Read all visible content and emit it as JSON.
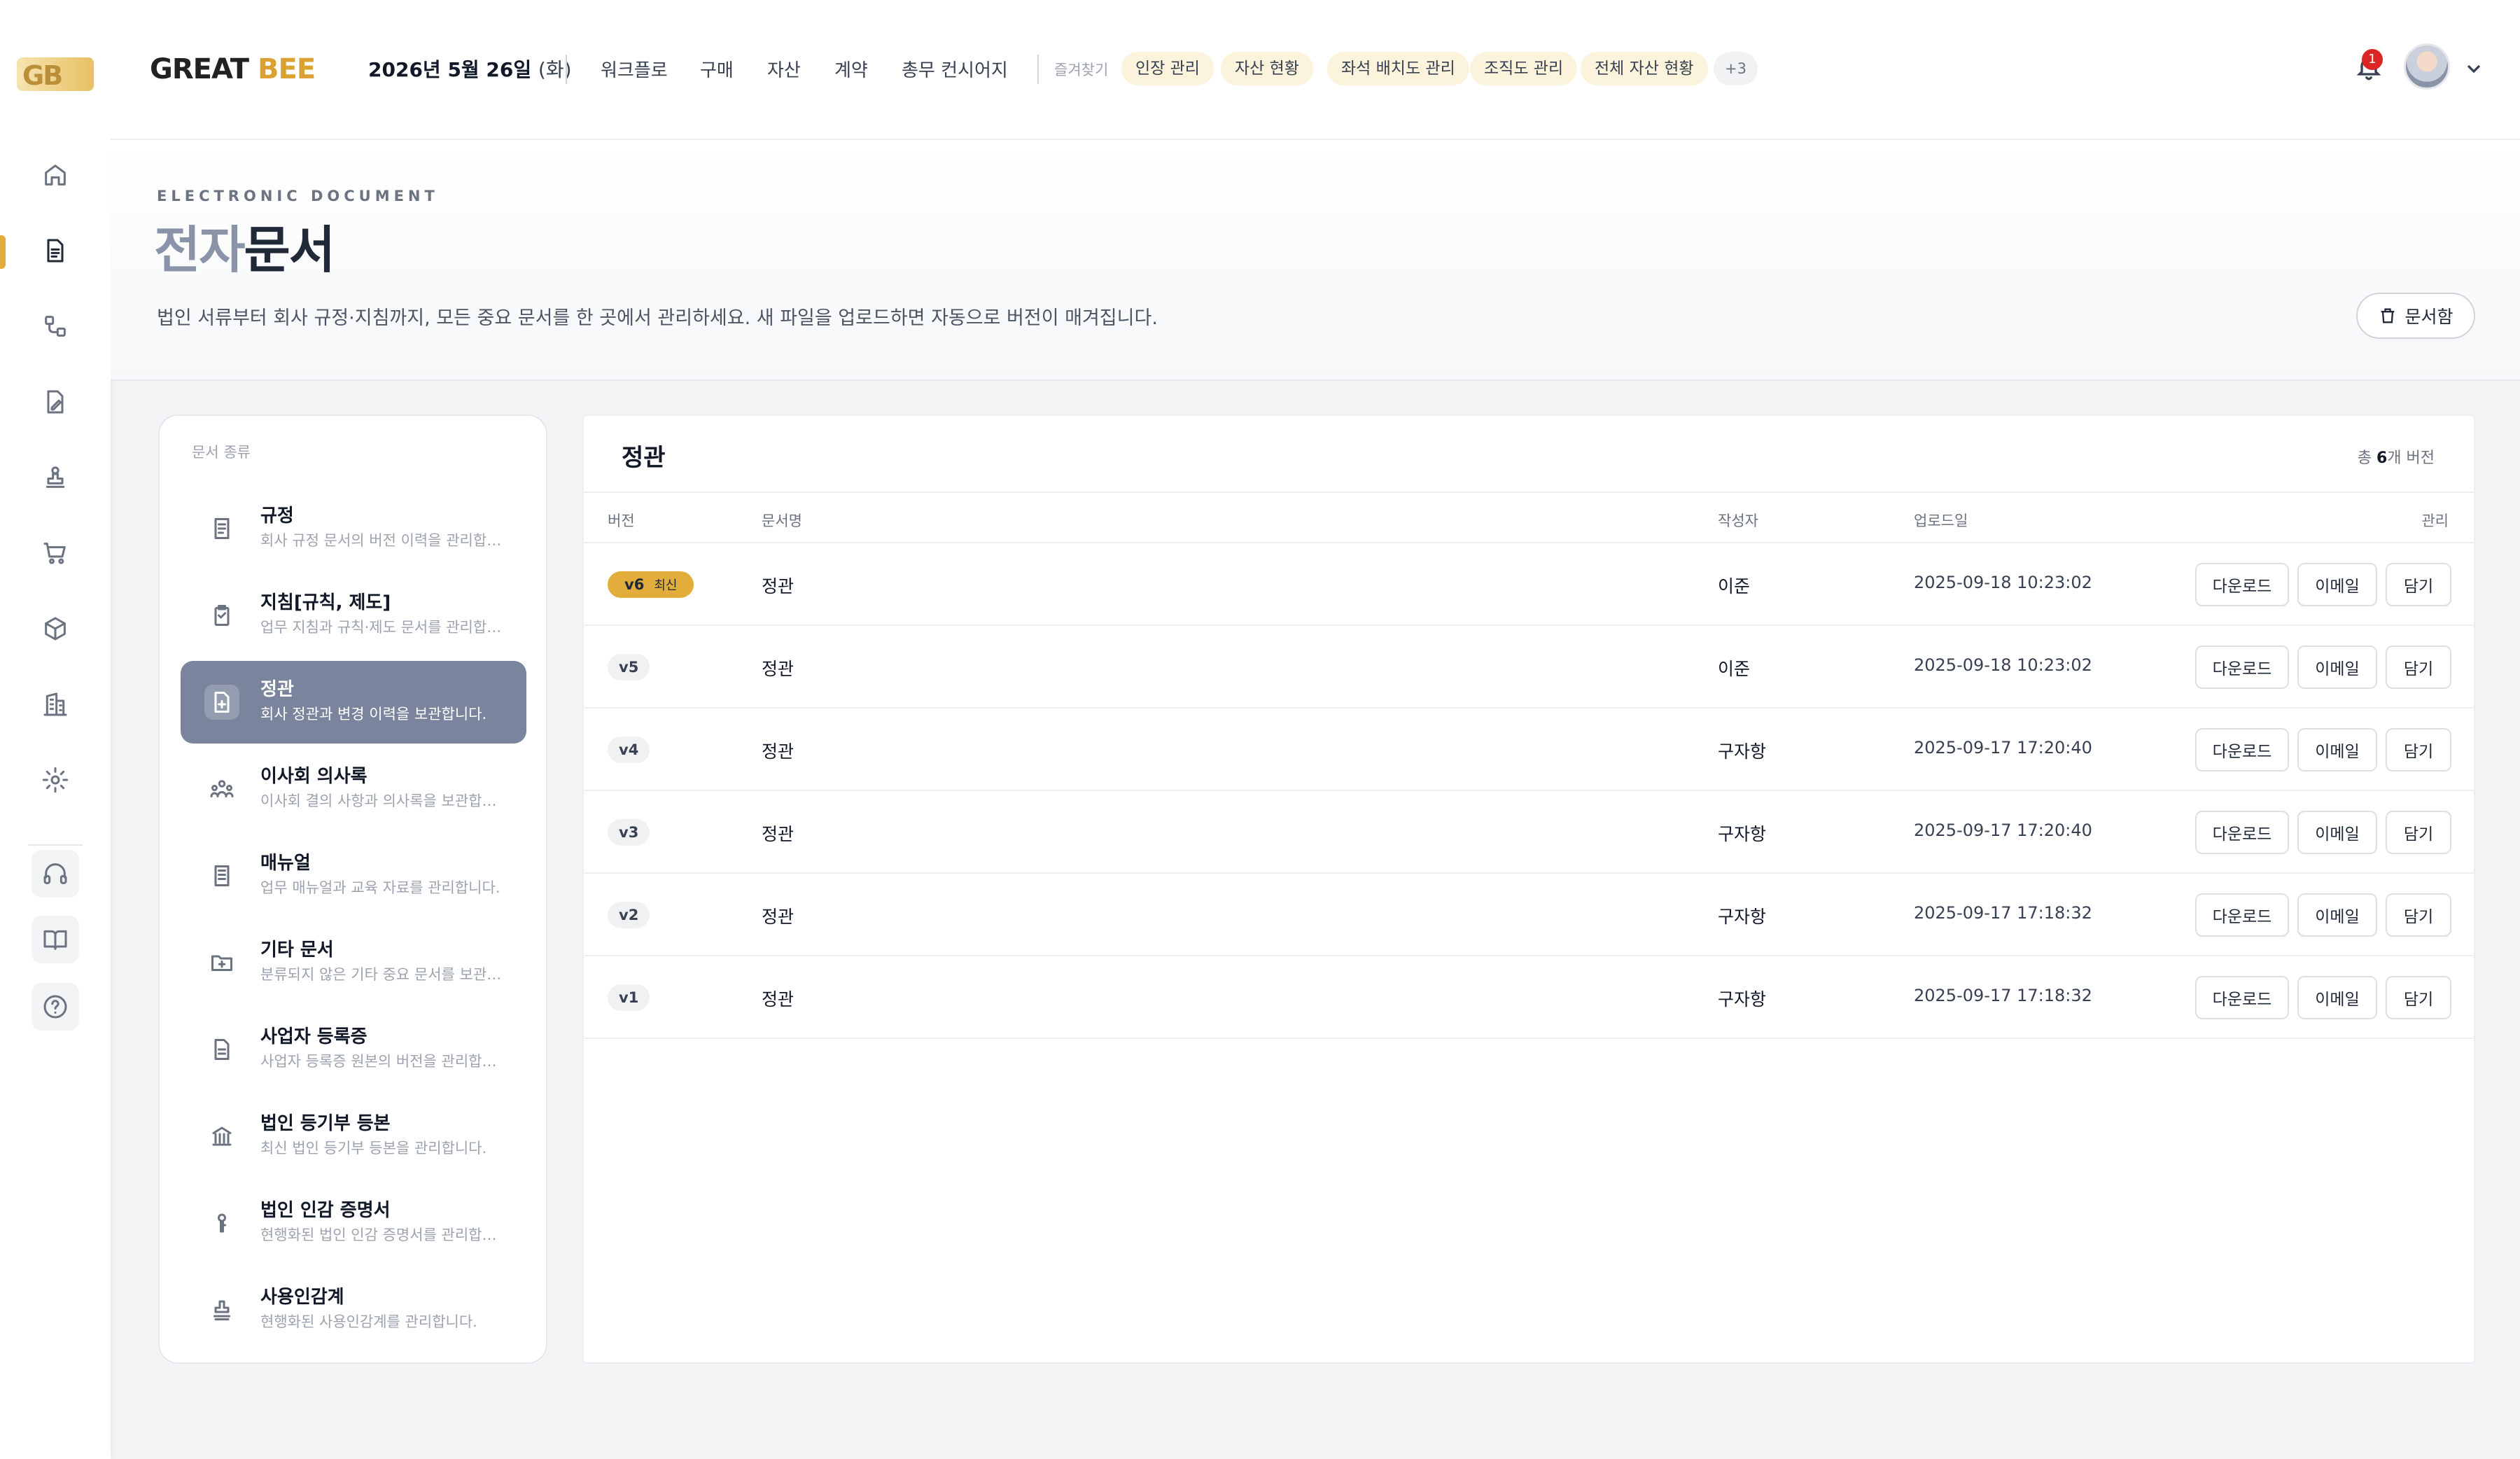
{
  "brand": {
    "logo_mark": "GB",
    "name_left": "GREAT ",
    "name_right": "BEE"
  },
  "header": {
    "date": "2026년 5월 26일",
    "weekday": "(화)",
    "nav": [
      "워크플로",
      "구매",
      "자산",
      "계약",
      "총무 컨시어지"
    ],
    "favorites_label": "즐겨찾기",
    "favorites": [
      "인장 관리",
      "자산 현황",
      "좌석 배치도 관리",
      "조직도 관리",
      "전체 자산 현황"
    ],
    "favorites_more": "+3",
    "notification_count": "1"
  },
  "sidebar_icons": [
    "home-icon",
    "document-icon",
    "workflow-icon",
    "contract-icon",
    "seal-icon",
    "cart-icon",
    "box-icon",
    "building-icon",
    "settings-icon",
    "headset-icon",
    "book-icon",
    "help-icon"
  ],
  "page": {
    "eyebrow": "ELECTRONIC DOCUMENT",
    "title_accent": "전자",
    "title_rest": "문서",
    "description": "법인 서류부터 회사 규정·지침까지, 모든 중요 문서를 한 곳에서 관리하세요. 새 파일을 업로드하면 자동으로 버전이 매겨집니다.",
    "docbox_label": "문서함"
  },
  "categories": {
    "heading": "문서 종류",
    "items": [
      {
        "title": "규정",
        "desc": "회사 규정 문서의 버전 이력을 관리합니다.",
        "icon": "list-doc-icon"
      },
      {
        "title": "지침[규칙, 제도]",
        "desc": "업무 지침과 규칙·제도 문서를 관리합니다.",
        "icon": "clipboard-icon"
      },
      {
        "title": "정관",
        "desc": "회사 정관과 변경 이력을 보관합니다.",
        "icon": "file-plus-icon"
      },
      {
        "title": "이사회 의사록",
        "desc": "이사회 결의 사항과 의사록을 보관합니다.",
        "icon": "people-icon"
      },
      {
        "title": "매뉴얼",
        "desc": "업무 매뉴얼과 교육 자료를 관리합니다.",
        "icon": "manual-icon"
      },
      {
        "title": "기타 문서",
        "desc": "분류되지 않은 기타 중요 문서를 보관합니다.",
        "icon": "folder-plus-icon"
      },
      {
        "title": "사업자 등록증",
        "desc": "사업자 등록증 원본의 버전을 관리합니다.",
        "icon": "file-text-icon"
      },
      {
        "title": "법인 등기부 등본",
        "desc": "최신 법인 등기부 등본을 관리합니다.",
        "icon": "bank-icon"
      },
      {
        "title": "법인 인감 증명서",
        "desc": "현행화된 법인 인감 증명서를 관리합니다.",
        "icon": "stamp-key-icon"
      },
      {
        "title": "사용인감계",
        "desc": "현행화된 사용인감계를 관리합니다.",
        "icon": "stamp-icon"
      }
    ]
  },
  "panel": {
    "title": "정관",
    "count_prefix": "총",
    "count_value": "6",
    "count_suffix": "개 버전",
    "columns": [
      "버전",
      "문서명",
      "작성자",
      "업로드일",
      "관리"
    ],
    "latest_label": "최신",
    "actions": [
      "다운로드",
      "이메일",
      "담기"
    ],
    "rows": [
      {
        "version": "v6",
        "name": "정관",
        "author": "이준",
        "date": "2025-09-18 10:23:02"
      },
      {
        "version": "v5",
        "name": "정관",
        "author": "이준",
        "date": "2025-09-18 10:23:02"
      },
      {
        "version": "v4",
        "name": "정관",
        "author": "구자항",
        "date": "2025-09-17 17:20:40"
      },
      {
        "version": "v3",
        "name": "정관",
        "author": "구자항",
        "date": "2025-09-17 17:20:40"
      },
      {
        "version": "v2",
        "name": "정관",
        "author": "구자항",
        "date": "2025-09-17 17:18:32"
      },
      {
        "version": "v1",
        "name": "정관",
        "author": "구자항",
        "date": "2025-09-17 17:18:32"
      }
    ]
  }
}
